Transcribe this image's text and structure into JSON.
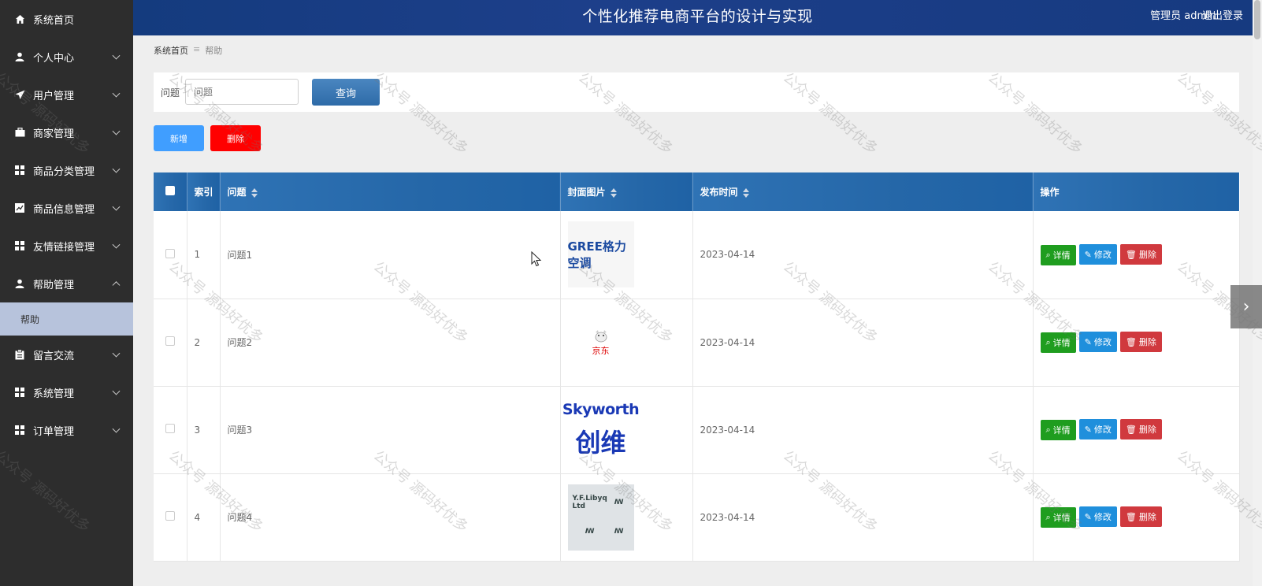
{
  "header": {
    "title": "个性化推荐电商平台的设计与实现",
    "user": "管理员 admin",
    "logout": "退出登录"
  },
  "sidebar": {
    "items": [
      {
        "label": "系统首页",
        "icon": "home-icon"
      },
      {
        "label": "个人中心",
        "icon": "user-icon"
      },
      {
        "label": "用户管理",
        "icon": "send-icon"
      },
      {
        "label": "商家管理",
        "icon": "briefcase-icon"
      },
      {
        "label": "商品分类管理",
        "icon": "grid-icon"
      },
      {
        "label": "商品信息管理",
        "icon": "chart-icon"
      },
      {
        "label": "友情链接管理",
        "icon": "grid-icon"
      },
      {
        "label": "帮助管理",
        "icon": "user-icon"
      },
      {
        "label": "留言交流",
        "icon": "clipboard-icon"
      },
      {
        "label": "系统管理",
        "icon": "grid-icon"
      },
      {
        "label": "订单管理",
        "icon": "grid-icon"
      }
    ],
    "sub_help": "帮助"
  },
  "breadcrumb": {
    "home": "系统首页",
    "current": "帮助"
  },
  "search": {
    "label": "问题",
    "placeholder": "问题",
    "button": "查询"
  },
  "toolbar": {
    "add": "新增",
    "delete": "删除"
  },
  "table": {
    "headers": {
      "index": "索引",
      "question": "问题",
      "cover": "封面图片",
      "date": "发布时间",
      "actions": "操作"
    },
    "rows": [
      {
        "index": "1",
        "question": "问题1",
        "date": "2023-04-14",
        "cover_text": "GREE格力空调"
      },
      {
        "index": "2",
        "question": "问题2",
        "date": "2023-04-14",
        "cover_text": "京东"
      },
      {
        "index": "3",
        "question": "问题3",
        "date": "2023-04-14",
        "cover_text": "Skyworth",
        "cover_text2": "创维"
      },
      {
        "index": "4",
        "question": "问题4",
        "date": "2023-04-14",
        "cover_text": "Y.F.Libyq Ltd"
      }
    ],
    "actions": {
      "detail": "详情",
      "edit": "修改",
      "remove": "删除"
    }
  },
  "watermark": "公众号 源码好优多"
}
